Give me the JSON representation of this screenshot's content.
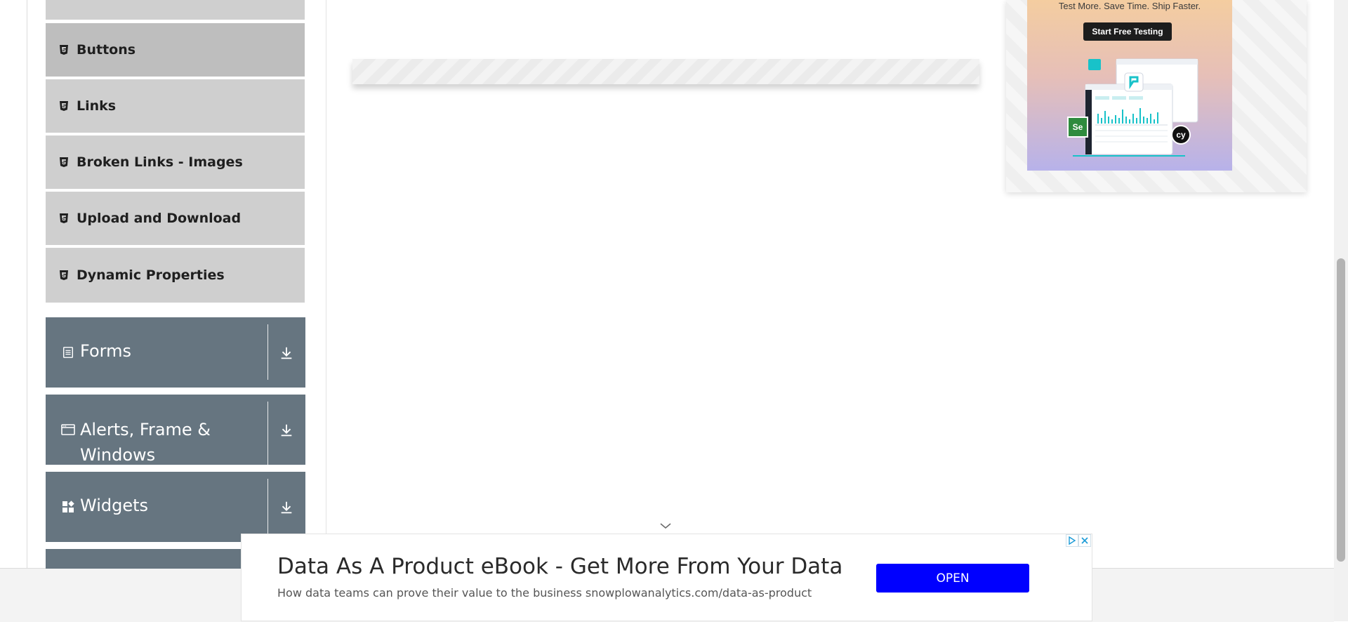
{
  "sidebar": {
    "elements_items": [
      {
        "label": "Buttons",
        "active": true
      },
      {
        "label": "Links"
      },
      {
        "label": "Broken Links - Images"
      },
      {
        "label": "Upload and Download"
      },
      {
        "label": "Dynamic Properties"
      }
    ],
    "groups": [
      {
        "title": "Forms",
        "icon": "form-icon"
      },
      {
        "title": "Alerts, Frame &",
        "title2": "Windows",
        "icon": "window-icon"
      },
      {
        "title": "Widgets",
        "icon": "widgets-icon"
      }
    ]
  },
  "right_ad": {
    "tagline": "Test More. Save Time. Ship Faster.",
    "cta": "Start Free Testing",
    "logo_se": "Se",
    "logo_cy": "cy"
  },
  "bottom_ad": {
    "headline": "Data As A Product eBook - Get More From Your Data",
    "subline": "How data teams can prove their value to the business snowplowanalytics.com/data-as-product",
    "button": "OPEN"
  },
  "colors": {
    "sidebar_group_bg": "#667580",
    "sub_item_bg": "#cfcfcf",
    "active_sub_item_bg": "#bebebe",
    "open_button": "#0000ff"
  }
}
